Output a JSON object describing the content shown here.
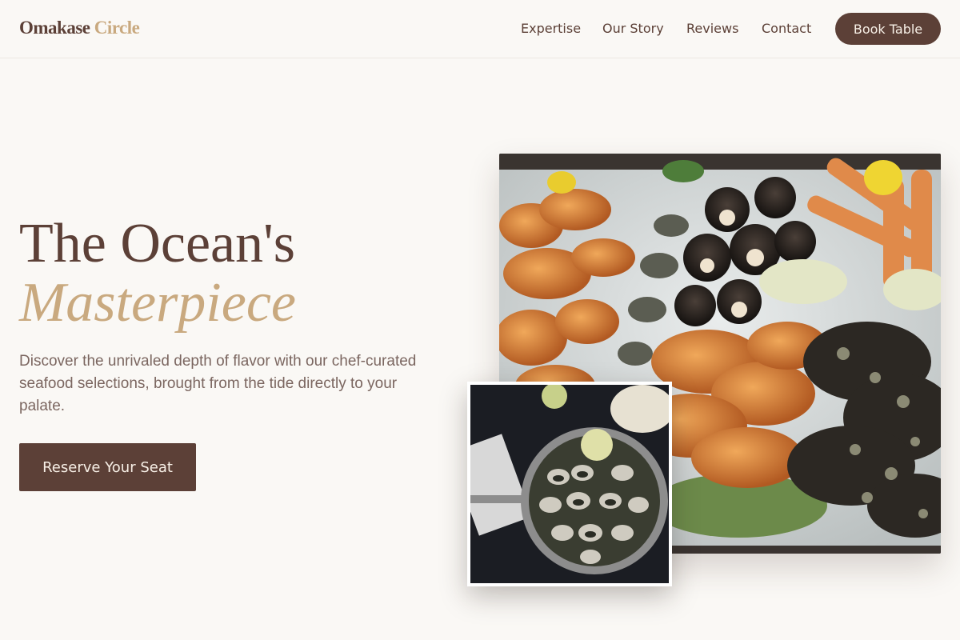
{
  "brand": {
    "name_main": "Omakase",
    "name_accent": "Circle"
  },
  "nav": {
    "items": [
      {
        "label": "Expertise"
      },
      {
        "label": "Our Story"
      },
      {
        "label": "Reviews"
      },
      {
        "label": "Contact"
      }
    ],
    "cta_label": "Book Table"
  },
  "hero": {
    "title_line1": "The Ocean's",
    "title_line2": "Masterpiece",
    "description": "Discover the unrivaled depth of flavor with our chef-curated seafood selections, brought from the tide directly to your palate.",
    "cta_label": "Reserve Your Seat"
  },
  "images": {
    "main": "seafood-platter-on-ice",
    "inset": "steamed-clams-in-pan"
  },
  "colors": {
    "background": "#faf8f5",
    "brand_brown": "#5c4037",
    "accent_gold": "#c9a97f",
    "body_text": "#7b6660"
  }
}
